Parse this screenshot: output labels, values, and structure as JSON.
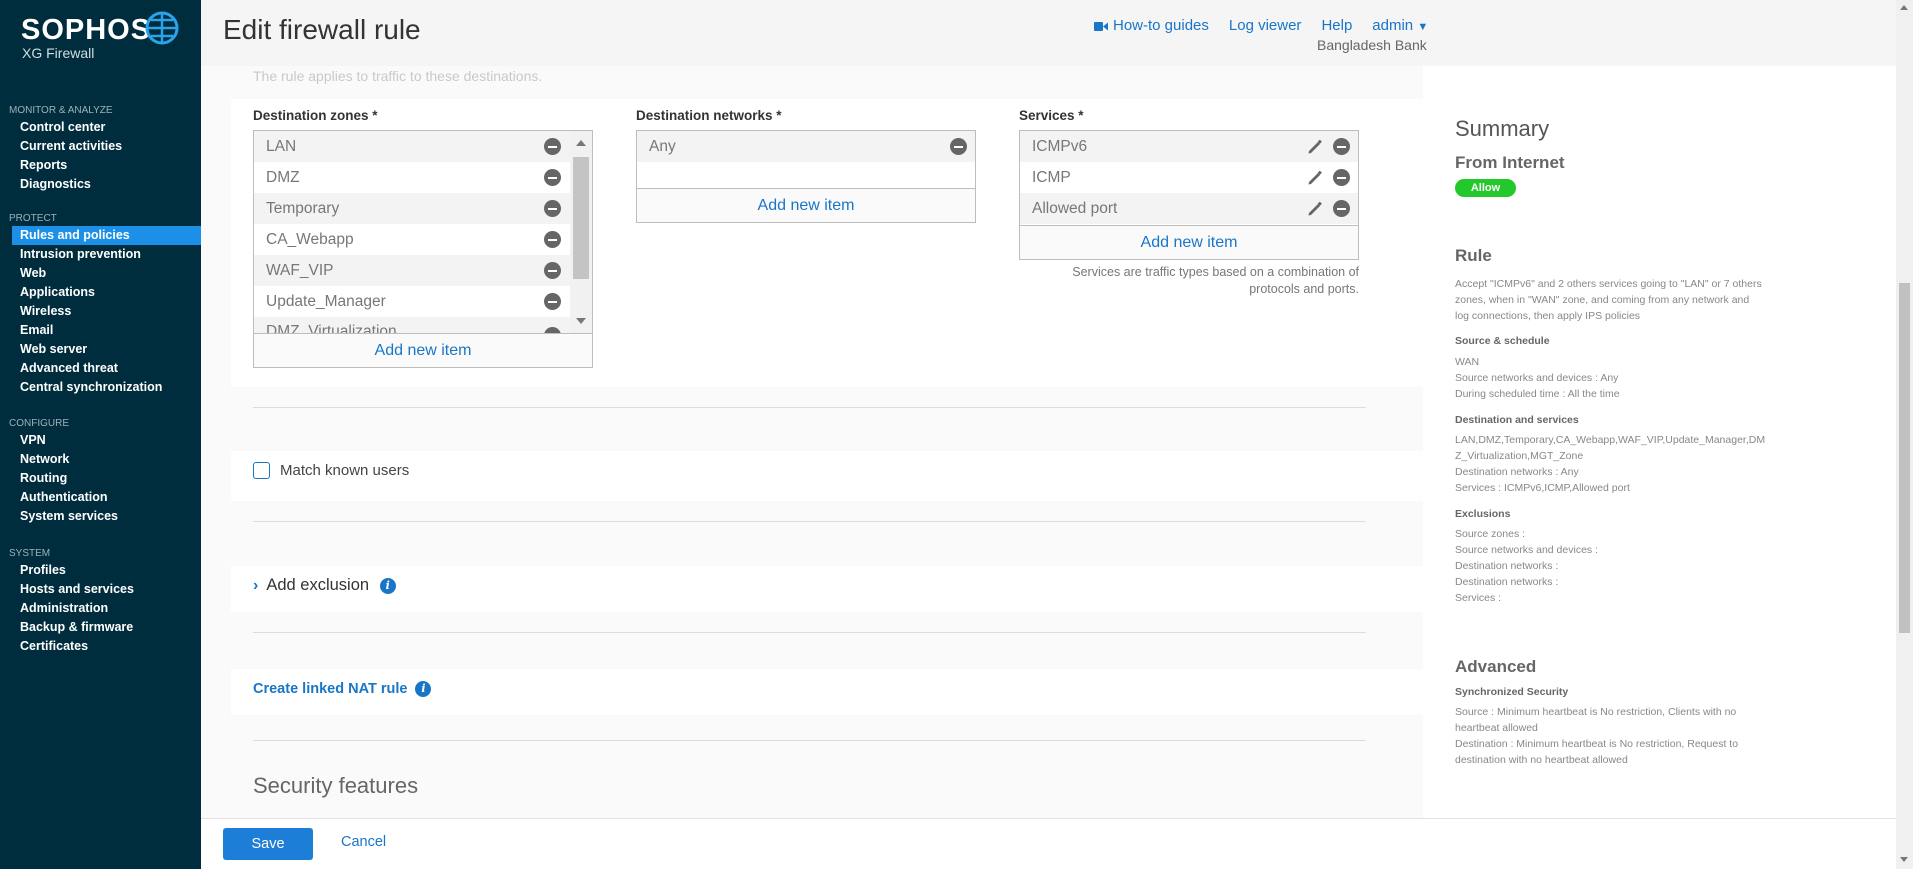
{
  "brand": {
    "name": "SOPHOS",
    "product": "XG Firewall"
  },
  "sidebar": {
    "sections": [
      {
        "title": "MONITOR & ANALYZE",
        "items": [
          "Control center",
          "Current activities",
          "Reports",
          "Diagnostics"
        ]
      },
      {
        "title": "PROTECT",
        "items": [
          "Rules and policies",
          "Intrusion prevention",
          "Web",
          "Applications",
          "Wireless",
          "Email",
          "Web server",
          "Advanced threat",
          "Central synchronization"
        ]
      },
      {
        "title": "CONFIGURE",
        "items": [
          "VPN",
          "Network",
          "Routing",
          "Authentication",
          "System services"
        ]
      },
      {
        "title": "SYSTEM",
        "items": [
          "Profiles",
          "Hosts and services",
          "Administration",
          "Backup & firmware",
          "Certificates"
        ]
      }
    ],
    "active": "Rules and policies"
  },
  "header": {
    "title": "Edit firewall rule",
    "links": {
      "guides": "How-to guides",
      "log": "Log viewer",
      "help": "Help",
      "user": "admin"
    },
    "org": "Bangladesh Bank"
  },
  "main": {
    "faded_text": "The rule applies to traffic to these destinations.",
    "dest_zones": {
      "label": "Destination zones *",
      "items": [
        "LAN",
        "DMZ",
        "Temporary",
        "CA_Webapp",
        "WAF_VIP",
        "Update_Manager",
        "DMZ_Virtualization"
      ],
      "add": "Add new item"
    },
    "dest_networks": {
      "label": "Destination networks *",
      "items": [
        "Any"
      ],
      "add": "Add new item"
    },
    "services": {
      "label": "Services *",
      "items": [
        "ICMPv6",
        "ICMP",
        "Allowed port"
      ],
      "add": "Add new item",
      "help_line1": "Services are traffic types based on a combination of",
      "help_line2": "protocols and ports."
    },
    "match_users": "Match known users",
    "add_exclusion": "Add exclusion",
    "linked_nat": "Create linked NAT rule",
    "security_features": "Security features"
  },
  "footer": {
    "save": "Save",
    "cancel": "Cancel"
  },
  "summary": {
    "title": "Summary",
    "rule_name": "From Internet",
    "action": "Allow",
    "rule_title": "Rule",
    "rule_desc": "Accept \"ICMPv6\" and 2 others services going to \"LAN\" or 7 others zones, when in \"WAN\" zone, and coming from any network and log connections, then apply IPS policies",
    "src_title": "Source & schedule",
    "src_lines": [
      "WAN",
      "Source networks and devices : Any",
      "During scheduled time : All the time"
    ],
    "dst_title": "Destination and services",
    "dst_lines": [
      "LAN,DMZ,Temporary,CA_Webapp,WAF_VIP,Update_Manager,DMZ_Virtualization,MGT_Zone",
      "Destination networks : Any",
      "Services : ICMPv6,ICMP,Allowed port"
    ],
    "excl_title": "Exclusions",
    "excl_lines": [
      "Source zones :",
      "Source networks and devices :",
      "Destination networks :",
      "Destination networks :",
      "Services :"
    ],
    "adv_title": "Advanced",
    "sync_title": "Synchronized Security",
    "sync_lines": [
      "Source : Minimum heartbeat is No restriction, Clients with no heartbeat allowed",
      "Destination : Minimum heartbeat is No restriction, Request to destination with no heartbeat allowed"
    ]
  }
}
